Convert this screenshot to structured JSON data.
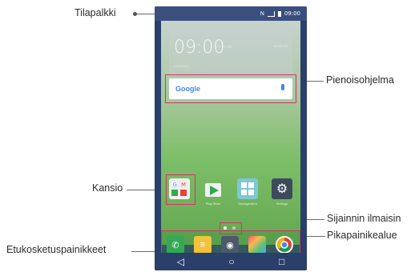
{
  "callouts": {
    "status_bar": "Tilapalkki",
    "widget": "Pienoisohjelma",
    "folder": "Kansio",
    "page_indicator": "Sijainnin ilmaisin",
    "quick_buttons": "Pikapainikealue",
    "front_touch_buttons": "Etukosketuspainikkeet"
  },
  "status_bar": {
    "time": "09:00"
  },
  "clock_widget": {
    "time": "09:00"
  },
  "search": {
    "logo": "Google"
  },
  "apps": [
    {
      "label": "Play Store"
    },
    {
      "label": "Management"
    },
    {
      "label": "Settings"
    }
  ],
  "icons": {
    "statusbar": [
      "nfc-icon",
      "signal-icon",
      "battery-icon"
    ],
    "navbar": [
      "back-icon",
      "home-icon",
      "recent-apps-icon"
    ],
    "dock": [
      "phone-icon",
      "messages-icon",
      "camera-icon",
      "gallery-icon",
      "chrome-icon"
    ]
  },
  "colors": {
    "highlight": "#d6336c",
    "phone_frame": "#2a3f6a",
    "wallpaper_green": "#7fbf6a"
  }
}
